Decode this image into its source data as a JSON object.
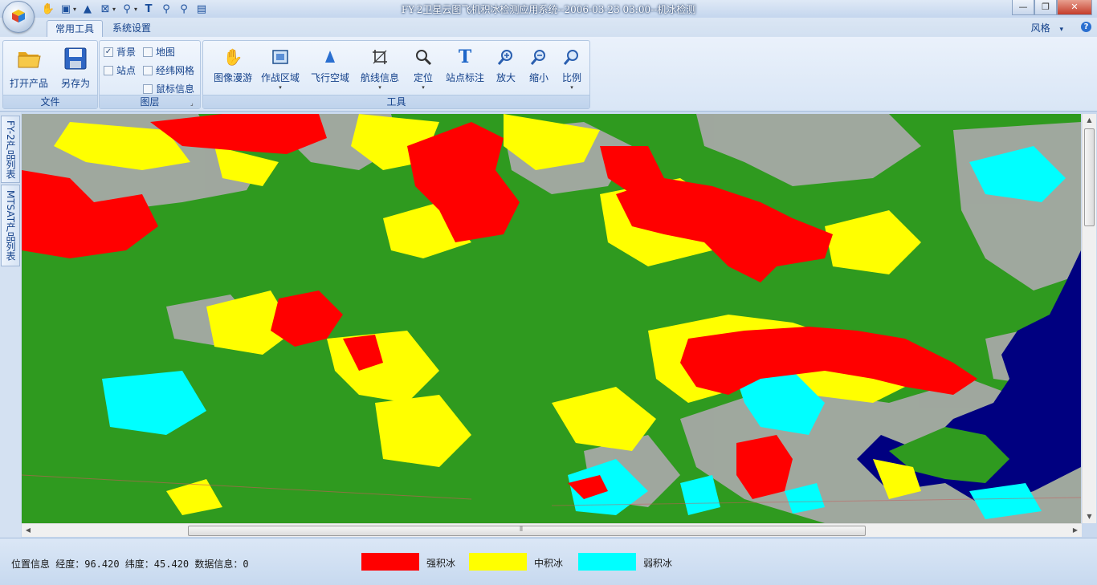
{
  "window": {
    "title": "FY-2卫星云图飞机积冰检测应用系统--2006-03-23 03:00--机冰检测",
    "min_symbol": "—",
    "max_symbol": "❐",
    "close_symbol": "✕"
  },
  "ribbon_tabs": [
    {
      "label": "常用工具",
      "active": true
    },
    {
      "label": "系统设置",
      "active": false
    }
  ],
  "style_menu": {
    "label": "风格",
    "arrow": "▾"
  },
  "help": {
    "symbol": "?"
  },
  "groups": {
    "file": {
      "label": "文件",
      "buttons": [
        {
          "label": "打开产品",
          "icon": "folder-icon"
        },
        {
          "label": "另存为",
          "icon": "floppy-disk-icon"
        }
      ]
    },
    "layers": {
      "label": "图层",
      "checkboxes": [
        {
          "label": "背景",
          "checked": true
        },
        {
          "label": "地图",
          "checked": false
        },
        {
          "label": "站点",
          "checked": false
        },
        {
          "label": "经纬网格",
          "checked": false
        },
        {
          "label": "鼠标信息",
          "checked": false
        }
      ]
    },
    "tools": {
      "label": "工具",
      "buttons": [
        {
          "label": "图像漫游",
          "icon": "hand-pan-icon",
          "dropdown": false
        },
        {
          "label": "作战区域",
          "icon": "region-frame-icon",
          "dropdown": true
        },
        {
          "label": "飞行空域",
          "icon": "airspace-triangle-icon",
          "dropdown": false
        },
        {
          "label": "航线信息",
          "icon": "route-crop-icon",
          "dropdown": true
        },
        {
          "label": "定位",
          "icon": "magnifier-icon",
          "dropdown": true
        },
        {
          "label": "站点标注",
          "icon": "text-t-icon",
          "dropdown": false
        },
        {
          "label": "放大",
          "icon": "zoom-in-icon",
          "dropdown": false
        },
        {
          "label": "缩小",
          "icon": "zoom-out-icon",
          "dropdown": false
        },
        {
          "label": "比例",
          "icon": "zoom-scale-icon",
          "dropdown": true
        }
      ]
    }
  },
  "side_tabs": [
    {
      "label": "FY-2产品列表"
    },
    {
      "label": "MTSAT产品列表"
    }
  ],
  "status": {
    "text": "位置信息 经度：96.420 纬度：45.420 数据信息：0"
  },
  "legend": [
    {
      "label": "强积冰",
      "color": "#ff0000"
    },
    {
      "label": "中积冰",
      "color": "#ffff00"
    },
    {
      "label": "弱积冰",
      "color": "#00ffff"
    }
  ],
  "map_colors": {
    "ground": "#2f9a1f",
    "cloud_gray": "#a9a9a9",
    "sea": "#000080",
    "strong": "#ff0000",
    "medium": "#ffff00",
    "weak": "#00ffff"
  }
}
